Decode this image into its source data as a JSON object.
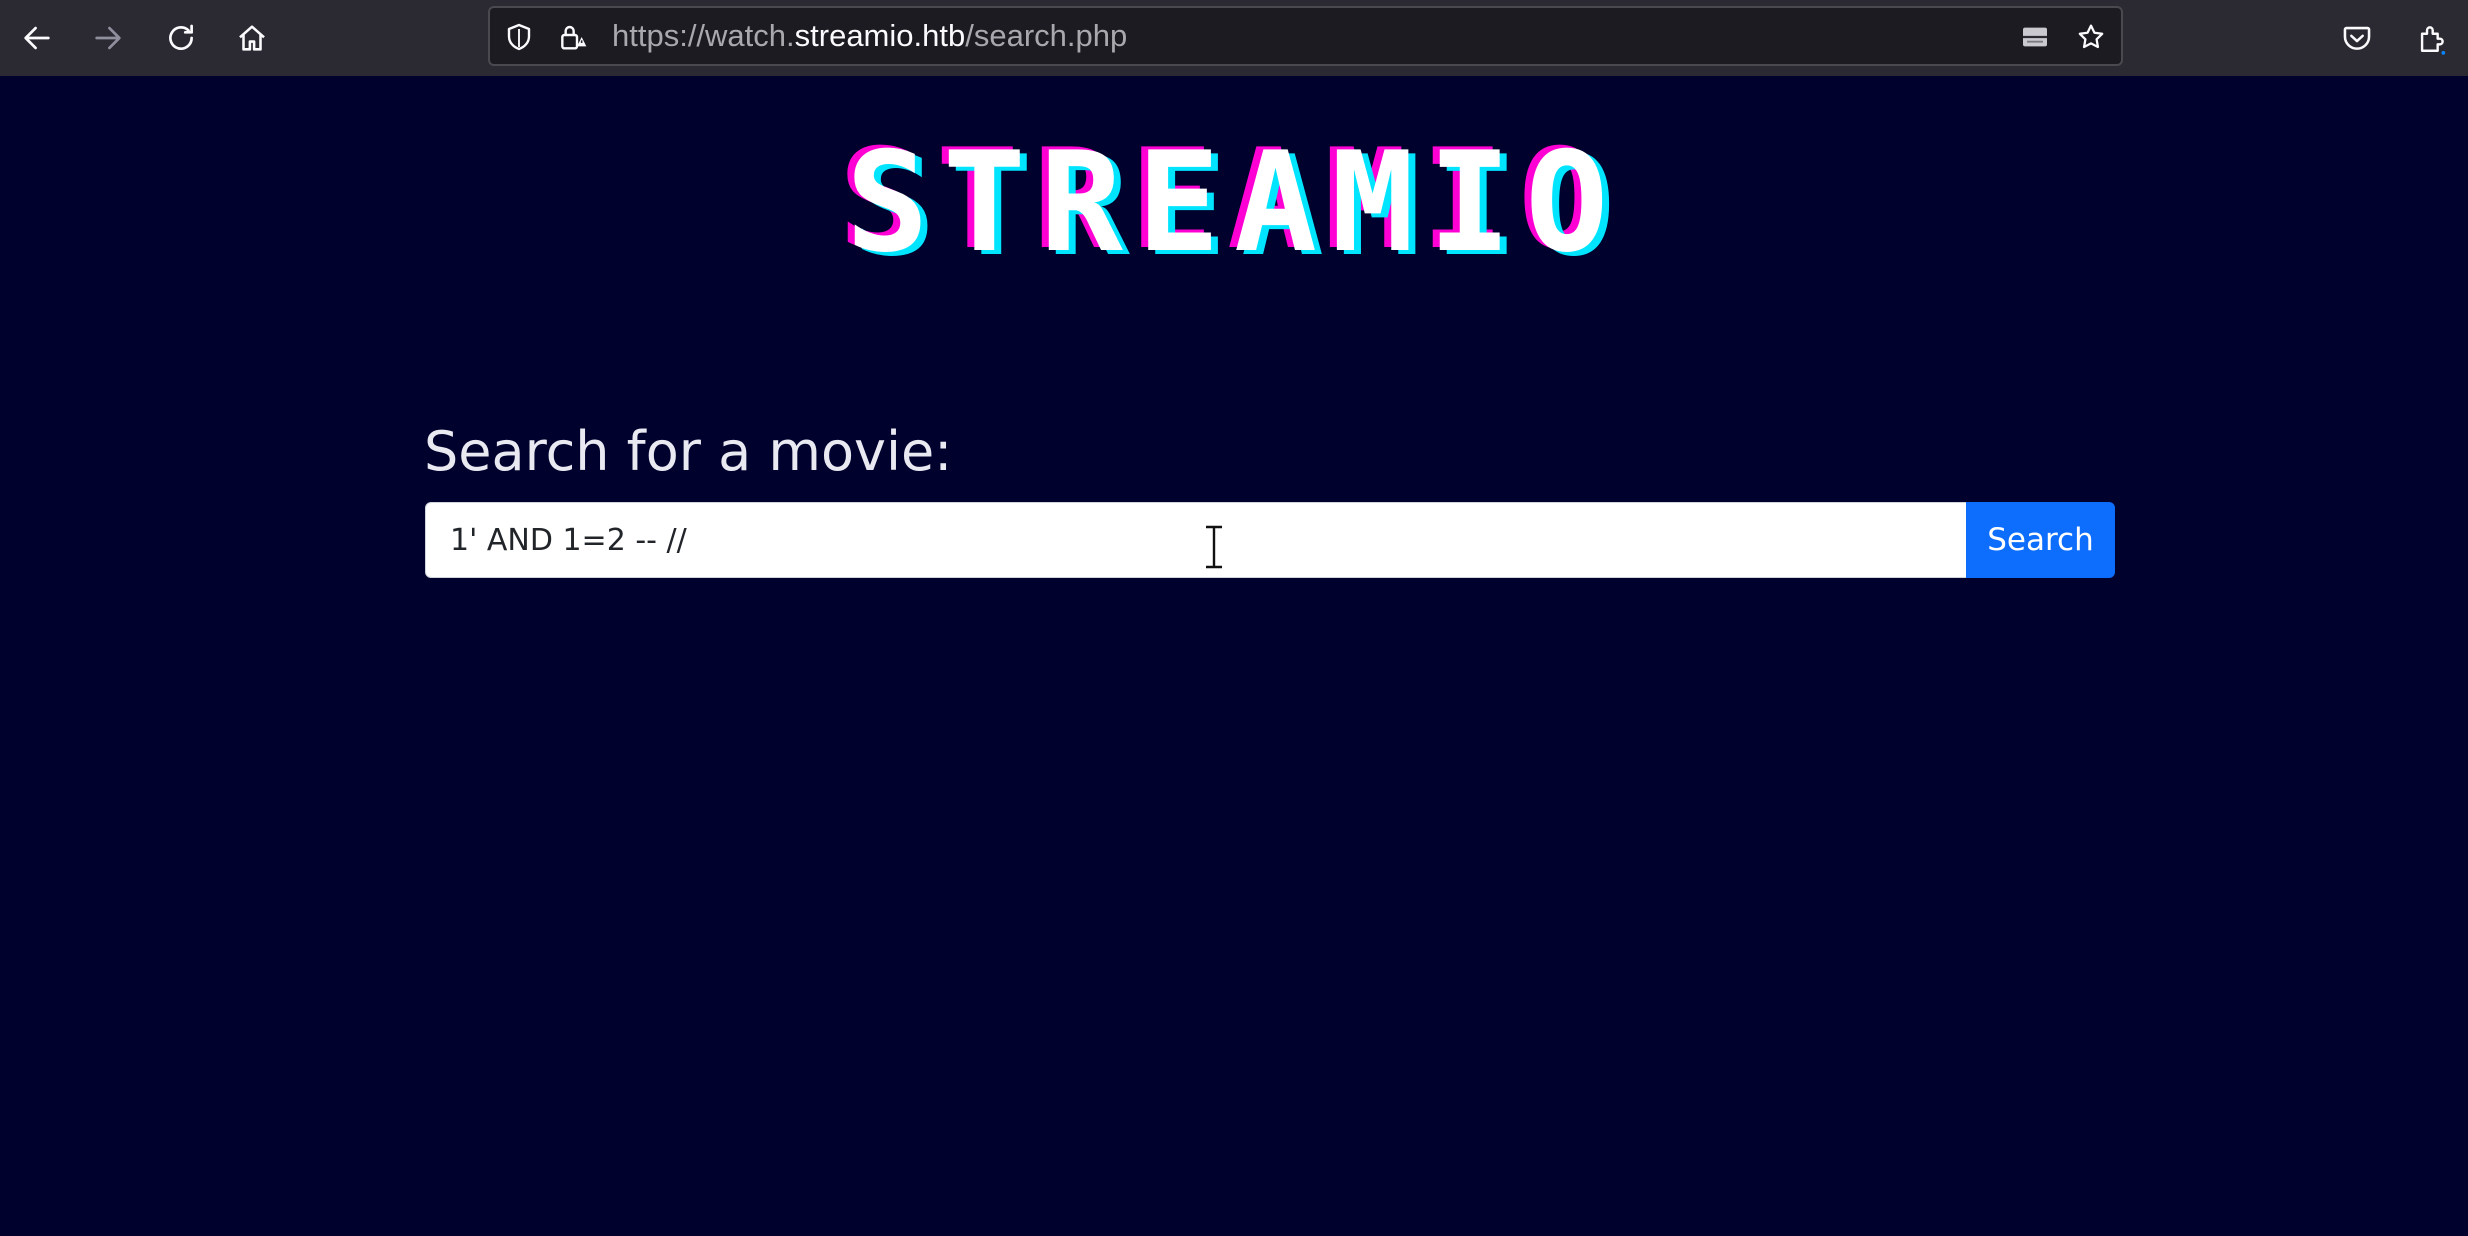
{
  "browser": {
    "url_prefix": "https://watch.",
    "url_host": "streamio.htb",
    "url_path": "/search.php",
    "icons": [
      "back-arrow-icon",
      "forward-arrow-icon",
      "reload-icon",
      "home-icon",
      "shield-icon",
      "insecure-lock-icon",
      "reader-view-icon",
      "star-icon",
      "pocket-icon",
      "extensions-icon"
    ]
  },
  "page": {
    "logo": "STREAMIO",
    "search_label": "Search for a movie:",
    "search_value": "1' AND 1=2 -- //",
    "search_button": "Search"
  },
  "colors": {
    "page_background": "#01012e",
    "button": "#0d6efd",
    "logo_cyan": "#00e5ff",
    "logo_magenta": "#ff00d4"
  }
}
